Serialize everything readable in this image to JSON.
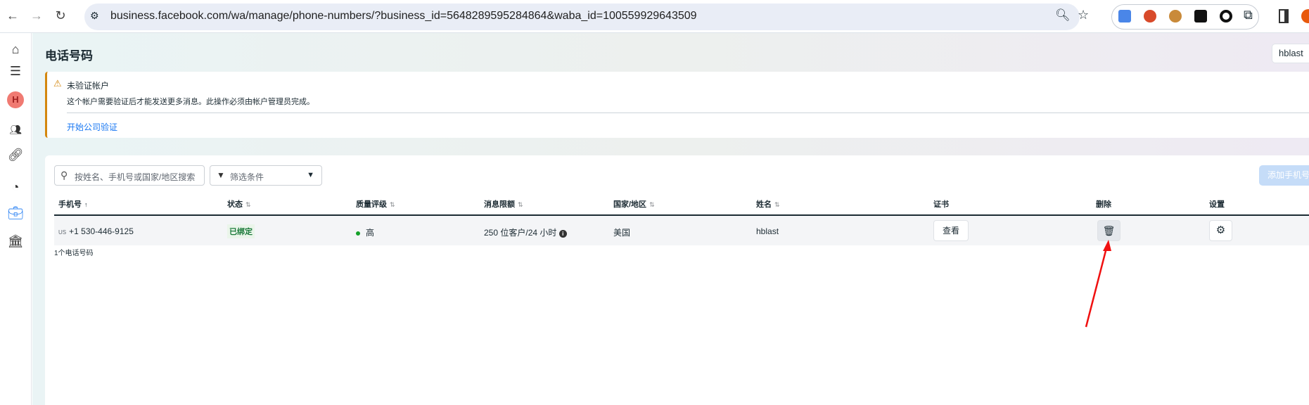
{
  "browser": {
    "url": "business.facebook.com/wa/manage/phone-numbers/?business_id=5648289595284864&waba_id=100559929643509",
    "icons": [
      "back-icon",
      "forward-icon",
      "reload-icon",
      "site-info-icon",
      "zoom-icon",
      "star-icon",
      "translate-icon",
      "extension-icon",
      "puzzle-icon",
      "side-panel-icon"
    ]
  },
  "sidebar": {
    "avatar_letter": "H",
    "icons": [
      "home-icon",
      "menu-icon",
      "people-icon",
      "link-icon",
      "gauge-icon",
      "briefcase-icon",
      "bank-icon"
    ]
  },
  "page": {
    "title": "电话号码",
    "account_button": "hblast"
  },
  "banner": {
    "title": "未验证帐户",
    "text": "这个帐户需要验证后才能发送更多消息。此操作必须由帐户管理员完成。",
    "link": "开始公司验证",
    "color": "#d4870e"
  },
  "toolbar": {
    "search_placeholder": "按姓名、手机号或国家/地区搜索",
    "filter_label": "筛选条件",
    "add_button": "添加手机号"
  },
  "table": {
    "columns": [
      {
        "label": "手机号",
        "sort": "↑"
      },
      {
        "label": "状态",
        "sort": "⇅"
      },
      {
        "label": "质量评级",
        "sort": "⇅"
      },
      {
        "label": "消息限额",
        "sort": "⇅"
      },
      {
        "label": "国家/地区",
        "sort": "⇅"
      },
      {
        "label": "姓名",
        "sort": "⇅"
      },
      {
        "label": "证书",
        "sort": ""
      },
      {
        "label": "删除",
        "sort": ""
      },
      {
        "label": "设置",
        "sort": ""
      }
    ],
    "rows": [
      {
        "country_code": "US",
        "phone": "+1 530-446-9125",
        "status": "已绑定",
        "quality": "高",
        "limit": "250 位客户/24 小时",
        "country": "美国",
        "name": "hblast",
        "cert_button": "查看"
      }
    ],
    "footer": "1个电话号码"
  }
}
